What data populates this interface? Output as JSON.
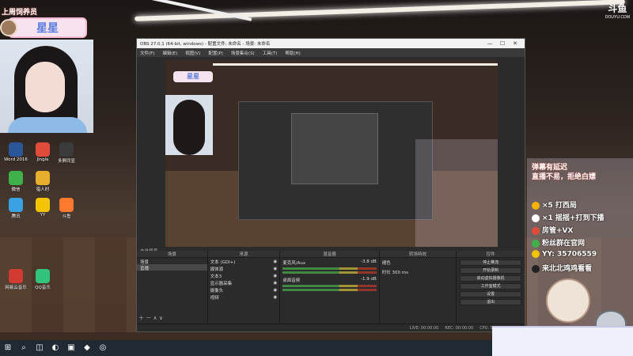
{
  "watermark": {
    "logo": "斗鱼",
    "url": "DOUYU.COM"
  },
  "streamer": {
    "badge": "上周饲养员",
    "name": "星星"
  },
  "desktop_icons": [
    {
      "label": "Word 2016",
      "color": "#2b579a"
    },
    {
      "label": "Jingle",
      "color": "#e04b3a"
    },
    {
      "label": "多屏同显",
      "color": "#3b3b3b"
    },
    {
      "label": "微信",
      "color": "#3fb04a"
    },
    {
      "label": "猎人时",
      "color": "#e6b02e"
    },
    {
      "label": "腾讯",
      "color": "#3aa1e2"
    },
    {
      "label": "YY",
      "color": "#f2c500"
    },
    {
      "label": "斗鱼",
      "color": "#ff7a2e"
    },
    {
      "label": "网易云音乐",
      "color": "#d33a31"
    },
    {
      "label": "QQ音乐",
      "color": "#31c27c"
    }
  ],
  "obs": {
    "title": "OBS 27.0.1 (64-bit, windows) - 配置文件: 未命名 - 场景: 未命名",
    "window_controls": {
      "minimize": "—",
      "maximize": "☐",
      "close": "✕"
    },
    "menu": [
      "文件(F)",
      "编辑(E)",
      "视图(V)",
      "配置(P)",
      "场景集合(S)",
      "工具(T)",
      "帮助(H)"
    ],
    "preview_card": "星星",
    "scene_label": "未选择源",
    "panels": {
      "scenes": {
        "title": "场景",
        "items": [
          "场景",
          "直播"
        ]
      },
      "sources": {
        "title": "来源",
        "items": [
          "文本 (GDI+)",
          "媒体源",
          "文本3",
          "显示器采集",
          "摄像头",
          "视频"
        ]
      },
      "mixer": {
        "title": "混音器",
        "rows": [
          {
            "name": "麦克风/Aux",
            "db": "-3.8 dB"
          },
          {
            "name": "桌面音频",
            "db": "-1.9 dB"
          }
        ]
      },
      "transitions": {
        "title": "转场特效",
        "type": "褪色",
        "duration_label": "时长",
        "duration": "300 ms"
      },
      "controls": {
        "title": "控件",
        "buttons": [
          "停止推流",
          "开始录制",
          "启动虚拟摄像机",
          "工作室模式",
          "设置",
          "退出"
        ]
      }
    },
    "status": [
      "LIVE: 00:00:00",
      "REC: 00:00:00",
      "CPU: 5.2%, 30.00 fps"
    ]
  },
  "right_overlay": {
    "notice_1": "弹幕有延迟",
    "notice_2": "直播不易，拒绝白嫖",
    "lines": [
      {
        "text": "×5 打西局",
        "color": "#f4b400"
      },
      {
        "text": "×1 摇摇+打到下播",
        "color": "#fff"
      },
      {
        "text": "房管+VX",
        "color": "#e04b3a"
      },
      {
        "text": "粉丝群在官网",
        "color": "#3fb04a"
      },
      {
        "text": "YY: 35706559",
        "color": "#f2c500"
      },
      {
        "text": "来北北鸡鸡看看",
        "color": "#222"
      }
    ]
  },
  "taskbar": {
    "icons": [
      "⊞",
      "⌕",
      "◫",
      "◐",
      "▣",
      "◆",
      "◎"
    ]
  }
}
